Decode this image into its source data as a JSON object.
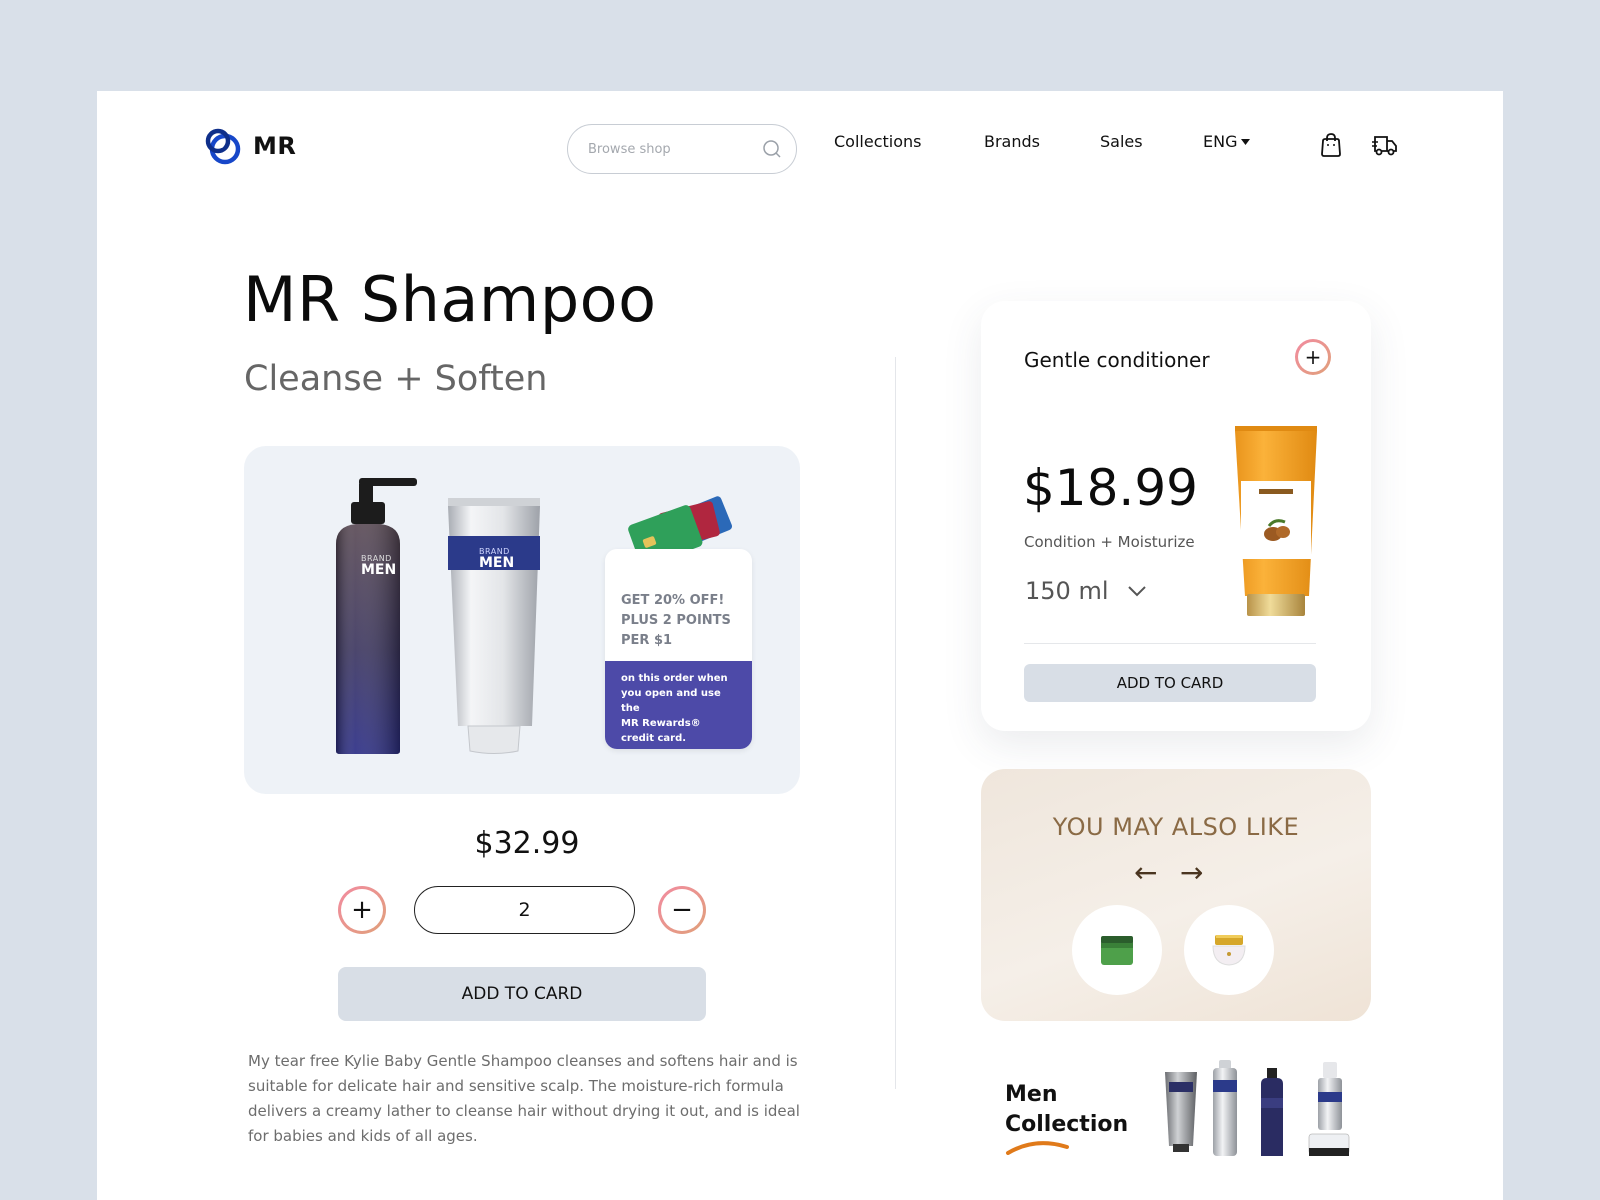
{
  "header": {
    "logo_text": "MR",
    "search_placeholder": "Browse shop",
    "nav": [
      "Collections",
      "Brands",
      "Sales"
    ],
    "language": "ENG"
  },
  "product": {
    "title": "MR Shampoo",
    "subtitle": "Cleanse + Soften",
    "price": "$32.99",
    "quantity": "2",
    "add_label": "ADD TO CARD",
    "description": "My tear free Kylie Baby Gentle Shampoo cleanses and softens hair and is suitable for delicate hair and sensitive scalp. The moisture-rich formula delivers a creamy lather to cleanse hair without drying it out, and is ideal for babies and kids of all ages.",
    "bottle_brand": "BRAND",
    "bottle_name": "MEN",
    "promo_headline": [
      "GET 20% OFF!",
      "PLUS 2 POINTS",
      "PER $1"
    ],
    "promo_detail": [
      "on this order when",
      "you open and use the",
      "MR Rewards®",
      "credit card."
    ]
  },
  "conditioner": {
    "title": "Gentle conditioner",
    "price": "$18.99",
    "subtitle": "Condition + Moisturize",
    "size": "150 ml",
    "add_label": "ADD TO CARD"
  },
  "also_like": {
    "title": "YOU MAY ALSO LIKE",
    "prev_arrow": "←",
    "next_arrow": "→"
  },
  "men_collection": {
    "line1": "Men",
    "line2": "Collection"
  },
  "colors": {
    "accent_blue": "#1747c9",
    "promo_purple": "#4d4aa8",
    "button_gray": "#d8dee6",
    "gold_text": "#8a6a45"
  }
}
